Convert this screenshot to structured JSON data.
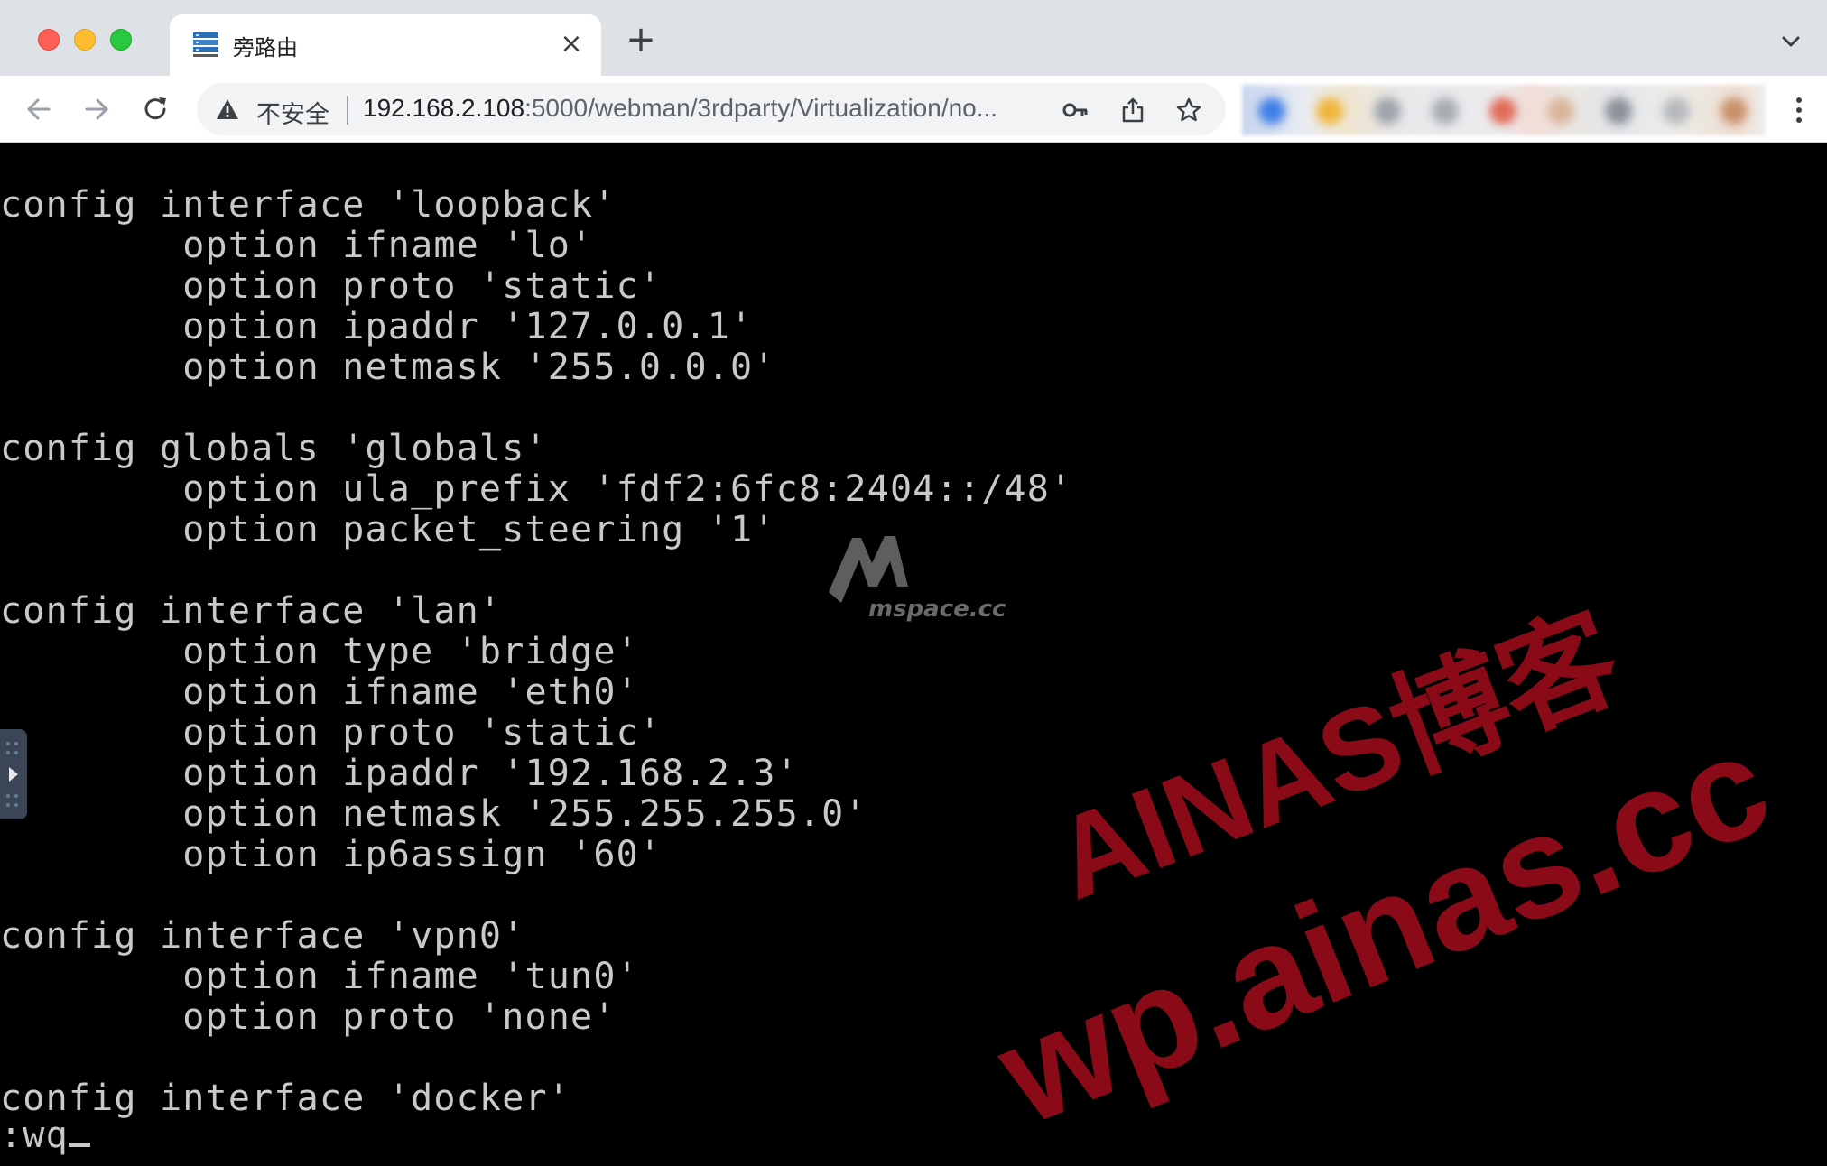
{
  "tab": {
    "title": "旁路由",
    "close": "×"
  },
  "new_tab": "+",
  "address_bar": {
    "security_label": "不安全",
    "url_host": "192.168.2.108",
    "url_rest": ":5000/webman/3rdparty/Virtualization/no..."
  },
  "terminal": {
    "lines": [
      "config interface 'loopback'",
      "        option ifname 'lo'",
      "        option proto 'static'",
      "        option ipaddr '127.0.0.1'",
      "        option netmask '255.0.0.0'",
      "",
      "config globals 'globals'",
      "        option ula_prefix 'fdf2:6fc8:2404::/48'",
      "        option packet_steering '1'",
      "",
      "config interface 'lan'",
      "        option type 'bridge'",
      "        option ifname 'eth0'",
      "        option proto 'static'",
      "        option ipaddr '192.168.2.3'",
      "        option netmask '255.255.255.0'",
      "        option ip6assign '60'",
      "",
      "config interface 'vpn0'",
      "        option ifname 'tun0'",
      "        option proto 'none'",
      "",
      "config interface 'docker'"
    ],
    "command": ":wq"
  },
  "watermarks": {
    "small_text": "mspace.cc",
    "red_line1": "AINAS博客",
    "red_line2": "wp.ainas.cc"
  },
  "colors": {
    "terminal_bg": "#000000",
    "terminal_fg": "#c9c9c9",
    "watermark_red": "#8b0a17"
  }
}
